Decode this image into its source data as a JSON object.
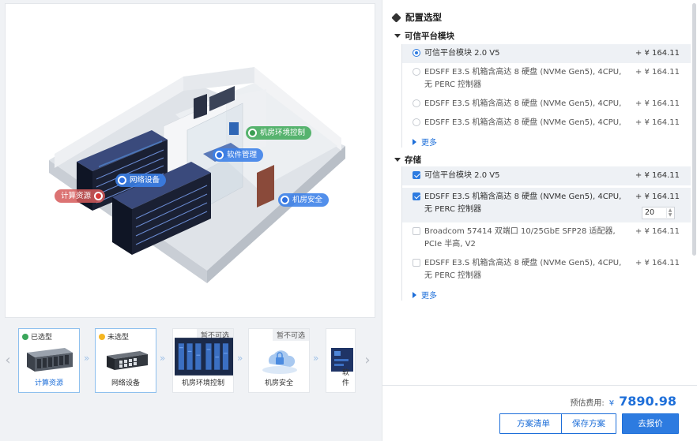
{
  "steps": [
    {
      "badge": "已选型",
      "badge_color": "#3aa65a",
      "name": "计算资源"
    },
    {
      "badge": "未选型",
      "badge_color": "#f5b622",
      "name": "网络设备"
    },
    {
      "badge": "暂不可选",
      "name": "机房环境控制"
    },
    {
      "badge": "暂不可选",
      "name": "机房安全"
    },
    {
      "name": "软件"
    }
  ],
  "scene_tags": {
    "compute": "计算资源",
    "network": "网络设备",
    "software": "软件管理",
    "env": "机房环境控制",
    "security": "机房安全"
  },
  "panel": {
    "title": "配置选型",
    "sections": [
      {
        "title": "可信平台模块",
        "items": [
          {
            "label": "可信平台模块 2.0 V5",
            "price": "+ ¥ 164.11"
          },
          {
            "label": "EDSFF E3.S 机箱含高达 8 硬盘 (NVMe Gen5), 4CPU, 无 PERC 控制器",
            "price": "+ ¥ 164.11"
          },
          {
            "label": "EDSFF E3.S 机箱含高达 8 硬盘 (NVMe Gen5), 4CPU,",
            "price": "+ ¥ 164.11"
          },
          {
            "label": "EDSFF E3.S 机箱含高达 8 硬盘 (NVMe Gen5), 4CPU,",
            "price": "+ ¥ 164.11"
          }
        ],
        "more": "更多"
      },
      {
        "title": "存储",
        "items": [
          {
            "label": "可信平台模块 2.0 V5",
            "price": "+ ¥ 164.11"
          },
          {
            "label": "EDSFF E3.S 机箱含高达 8 硬盘 (NVMe Gen5), 4CPU, 无 PERC 控制器",
            "price": "+ ¥ 164.11",
            "qty": "20"
          },
          {
            "label": "Broadcom 57414 双端口 10/25GbE SFP28 适配器, PCIe 半高, V2",
            "price": "+ ¥ 164.11"
          },
          {
            "label": "EDSFF E3.S 机箱含高达 8 硬盘 (NVMe Gen5), 4CPU, 无 PERC 控制器",
            "price": "+ ¥ 164.11"
          }
        ],
        "more": "更多"
      }
    ]
  },
  "footer": {
    "estimate_label": "预估费用:",
    "currency": "¥",
    "total": "7890.98",
    "buttons": {
      "list": "方案清单",
      "save": "保存方案",
      "quote": "去报价"
    }
  },
  "colors": {
    "accent": "#1e6fd9",
    "primary_button": "#2d7be0"
  }
}
